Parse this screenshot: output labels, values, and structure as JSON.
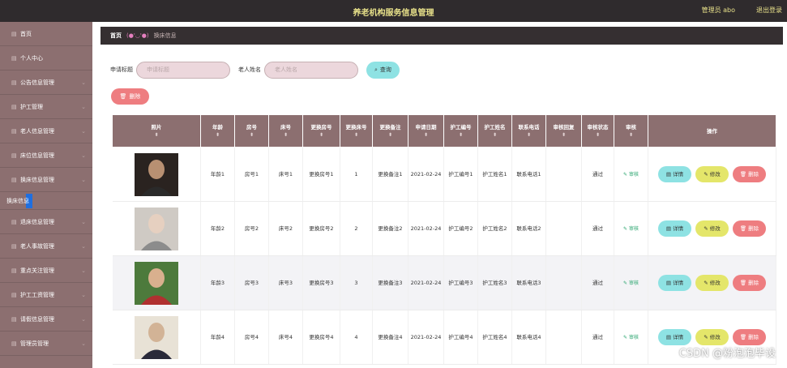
{
  "header": {
    "title": "养老机构服务信息管理",
    "user": "管理员 abo",
    "logout": "退出登录"
  },
  "sidebar": {
    "items": [
      {
        "label": "首页",
        "icon": "home-icon"
      },
      {
        "label": "个人中心",
        "icon": "user-icon"
      },
      {
        "label": "公告信息管理",
        "icon": "list-icon"
      },
      {
        "label": "护工管理",
        "icon": "list-icon"
      },
      {
        "label": "老人信息管理",
        "icon": "list-icon"
      },
      {
        "label": "床位信息管理",
        "icon": "list-icon"
      },
      {
        "label": "换床信息管理",
        "icon": "list-icon"
      },
      {
        "label": "退床信息管理",
        "icon": "list-icon"
      },
      {
        "label": "老人事故管理",
        "icon": "list-icon"
      },
      {
        "label": "重点关注管理",
        "icon": "list-icon"
      },
      {
        "label": "护工工资管理",
        "icon": "list-icon"
      },
      {
        "label": "请假信息管理",
        "icon": "list-icon"
      },
      {
        "label": "管理员管理",
        "icon": "list-icon"
      }
    ],
    "sub_item": "换床信息"
  },
  "breadcrumb": {
    "home": "首页",
    "face": "(●'◡'●)",
    "current": "换床信息"
  },
  "search": {
    "label1": "申请标题",
    "placeholder1": "申请标题",
    "label2": "老人姓名",
    "placeholder2": "老人姓名",
    "button": "查询"
  },
  "delete_label": "删除",
  "table": {
    "headers": [
      "照片",
      "年龄",
      "房号",
      "床号",
      "更换房号",
      "更换床号",
      "更换备注",
      "申请日期",
      "护工编号",
      "护工姓名",
      "联系电话",
      "审核回复",
      "审核状态",
      "审核",
      "操作"
    ],
    "rows": [
      {
        "age": "年龄1",
        "room": "房号1",
        "bed": "床号1",
        "new_room": "更换房号1",
        "new_bed": "1",
        "remark": "更换备注1",
        "date": "2021-02-24",
        "nurse_no": "护工编号1",
        "nurse_name": "护工姓名1",
        "phone": "联系电话1",
        "reply": "",
        "status": "通过"
      },
      {
        "age": "年龄2",
        "room": "房号2",
        "bed": "床号2",
        "new_room": "更换房号2",
        "new_bed": "2",
        "remark": "更换备注2",
        "date": "2021-02-24",
        "nurse_no": "护工编号2",
        "nurse_name": "护工姓名2",
        "phone": "联系电话2",
        "reply": "",
        "status": "通过"
      },
      {
        "age": "年龄3",
        "room": "房号3",
        "bed": "床号3",
        "new_room": "更换房号3",
        "new_bed": "3",
        "remark": "更换备注3",
        "date": "2021-02-24",
        "nurse_no": "护工编号3",
        "nurse_name": "护工姓名3",
        "phone": "联系电话3",
        "reply": "",
        "status": "通过"
      },
      {
        "age": "年龄4",
        "room": "房号4",
        "bed": "床号4",
        "new_room": "更换房号4",
        "new_bed": "4",
        "remark": "更换备注4",
        "date": "2021-02-24",
        "nurse_no": "护工编号4",
        "nurse_name": "护工姓名4",
        "phone": "联系电话4",
        "reply": "",
        "status": "通过"
      }
    ],
    "audit_label": "审核",
    "op_detail": "详情",
    "op_edit": "修改",
    "op_delete": "删除"
  },
  "watermark": "CSDN @粉泡泡毕设"
}
